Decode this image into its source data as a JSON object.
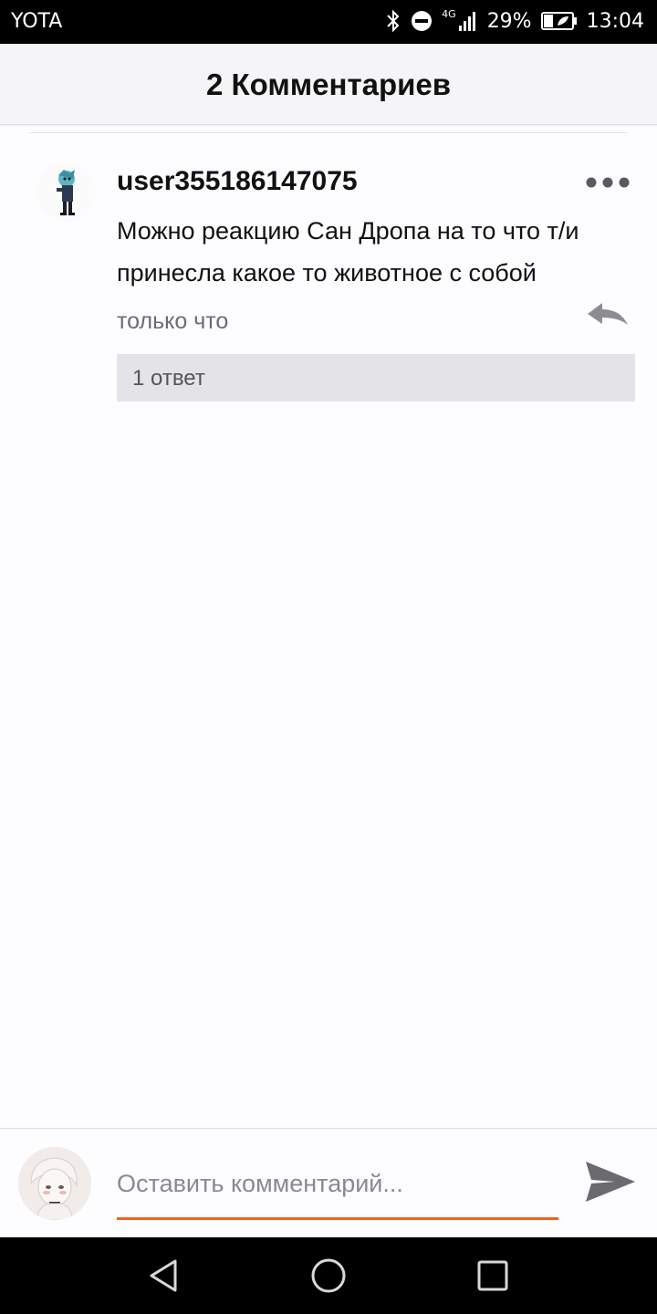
{
  "status_bar": {
    "carrier": "YOTA",
    "network": "4G",
    "battery": "29%",
    "time": "13:04"
  },
  "header": {
    "title": "2 Комментариев"
  },
  "comment": {
    "username": "user355186147075",
    "text": "Можно реакцию Сан Дропа на то что т/и принесла какое то животное с собой",
    "time": "только что",
    "replies_label": "1 ответ"
  },
  "composer": {
    "placeholder": "Оставить комментарий...",
    "value": "",
    "accent_color": "#f0641e"
  },
  "icons": {
    "status": [
      "bluetooth-icon",
      "dnd-icon",
      "signal-icon",
      "battery-icon"
    ],
    "comment": [
      "more-icon",
      "reply-icon"
    ],
    "composer": [
      "send-icon"
    ],
    "navigation": [
      "back-icon",
      "home-icon",
      "recents-icon"
    ]
  }
}
